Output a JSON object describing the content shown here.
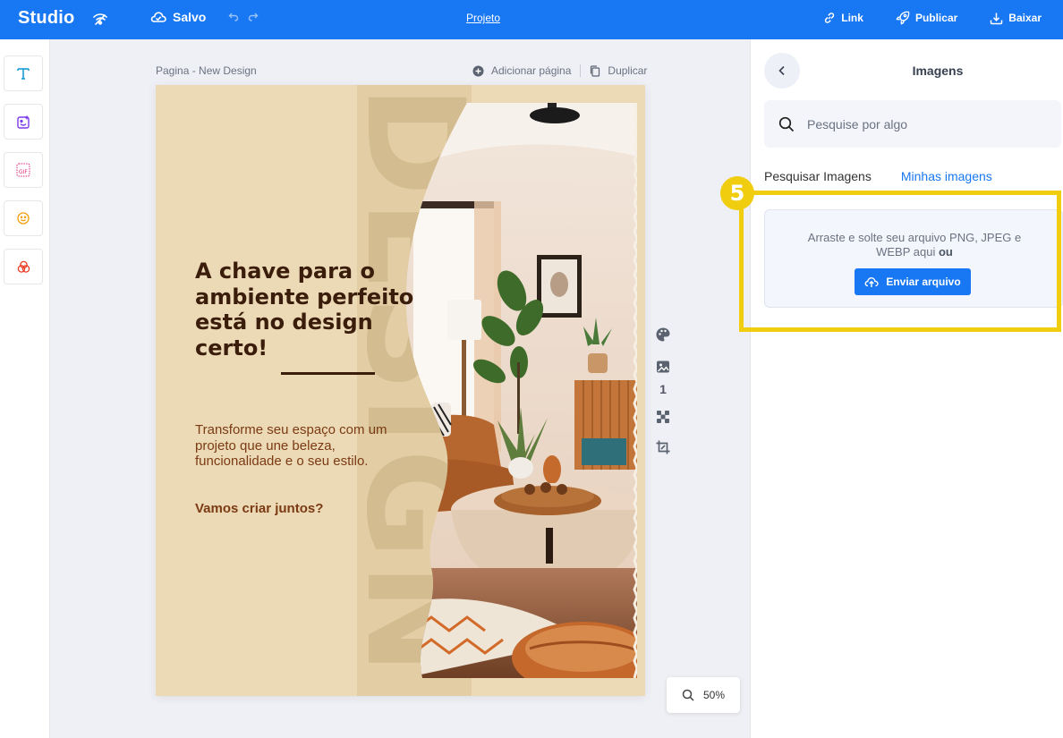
{
  "topbar": {
    "brand": "Studio",
    "saved_label": "Salvo",
    "project_label": "Projeto",
    "link_label": "Link",
    "publish_label": "Publicar",
    "download_label": "Baixar",
    "bg_color": "#1877f2"
  },
  "left_tools": [
    {
      "icon": "text-icon",
      "color": "#1a9bd7"
    },
    {
      "icon": "sticker-icon",
      "color": "#7c3aed"
    },
    {
      "icon": "gif-icon",
      "color": "#db2777"
    },
    {
      "icon": "emoji-icon",
      "color": "#f59e0b"
    },
    {
      "icon": "shapes-icon",
      "color": "#ea3b24"
    }
  ],
  "canvas": {
    "page_title": "Pagina - New Design",
    "add_page_label": "Adicionar página",
    "duplicate_label": "Duplicar",
    "page_number": "1",
    "zoom": "50%"
  },
  "design": {
    "vertical_text": "DESIGN",
    "headline": "A chave para o ambiente perfeito está no design certo!",
    "body": "Transforme seu espaço com um projeto que une beleza, funcionalidade e o seu estilo.",
    "cta": "Vamos criar juntos?",
    "bg_color": "#ecd9b5",
    "text_color": "#3b1d0c"
  },
  "panel": {
    "title": "Imagens",
    "search_placeholder": "Pesquise por algo",
    "tabs": [
      "Pesquisar Imagens",
      "Minhas imagens"
    ],
    "active_tab": "Minhas imagens",
    "upload_text": "Arraste e solte seu arquivo PNG, JPEG e WEBP aqui",
    "upload_or": "ou",
    "upload_button": "Enviar arquivo"
  },
  "tutorial": {
    "step": "5",
    "highlight_color": "#f1cd10"
  }
}
